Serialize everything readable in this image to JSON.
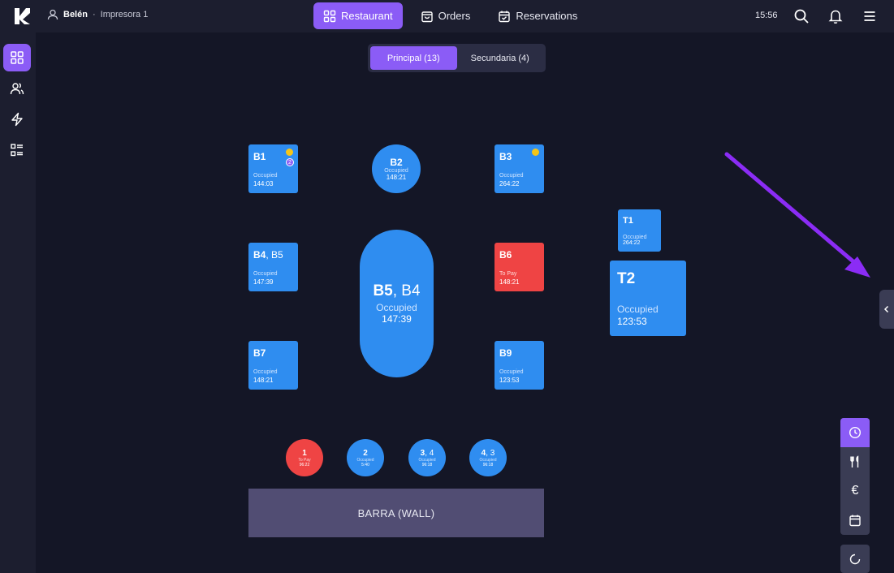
{
  "header": {
    "user_name": "Belén",
    "separator": "·",
    "printer": "Impresora 1",
    "nav": [
      {
        "label": "Restaurant",
        "active": true
      },
      {
        "label": "Orders",
        "active": false
      },
      {
        "label": "Reservations",
        "active": false
      }
    ],
    "time": "15:56"
  },
  "sidebar": {
    "items": [
      {
        "icon": "grid-icon",
        "active": true
      },
      {
        "icon": "users-icon",
        "active": false
      },
      {
        "icon": "lightning-icon",
        "active": false
      },
      {
        "icon": "list-icon",
        "active": false
      }
    ]
  },
  "tabs": [
    {
      "label": "Principal (13)",
      "active": true
    },
    {
      "label": "Secundaria (4)",
      "active": false
    }
  ],
  "tables": {
    "b1": {
      "name": "B1",
      "status": "Occupied",
      "time": "144:03",
      "badge": "2"
    },
    "b2": {
      "name": "B2",
      "status": "Occupied",
      "time": "148:21"
    },
    "b3": {
      "name": "B3",
      "status": "Occupied",
      "time": "264:22"
    },
    "b4": {
      "name": "B4",
      "joined": ", B5",
      "status": "Occupied",
      "time": "147:39"
    },
    "b5": {
      "name": "B5",
      "joined": ", B4",
      "status": "Occupied",
      "time": "147:39"
    },
    "b6": {
      "name": "B6",
      "status": "To Pay",
      "time": "148:21"
    },
    "b7": {
      "name": "B7",
      "status": "Occupied",
      "time": "148:21"
    },
    "b9": {
      "name": "B9",
      "status": "Occupied",
      "time": "123:53"
    },
    "t1": {
      "name": "T1",
      "status": "Occupied",
      "time": "264:22"
    },
    "t2": {
      "name": "T2",
      "status": "Occupied",
      "time": "123:53"
    },
    "s1": {
      "name": "1",
      "status": "To Pay",
      "time": "96:22"
    },
    "s2": {
      "name": "2",
      "status": "Occupied",
      "time": "5:40"
    },
    "s3": {
      "name": "3",
      "joined": ", 4",
      "status": "Occupied",
      "time": "96:18"
    },
    "s4": {
      "name": "4",
      "joined": ", 3",
      "status": "Occupied",
      "time": "96:18"
    }
  },
  "barra_label": "BARRA (WALL)",
  "right_panel": {
    "items": [
      "clock-icon",
      "cutlery-icon",
      "euro-icon",
      "calendar-icon"
    ],
    "euro_symbol": "€"
  },
  "colors": {
    "accent": "#8b5cf6",
    "occupied": "#2f8df0",
    "to_pay": "#ef4444",
    "background": "#141626"
  }
}
